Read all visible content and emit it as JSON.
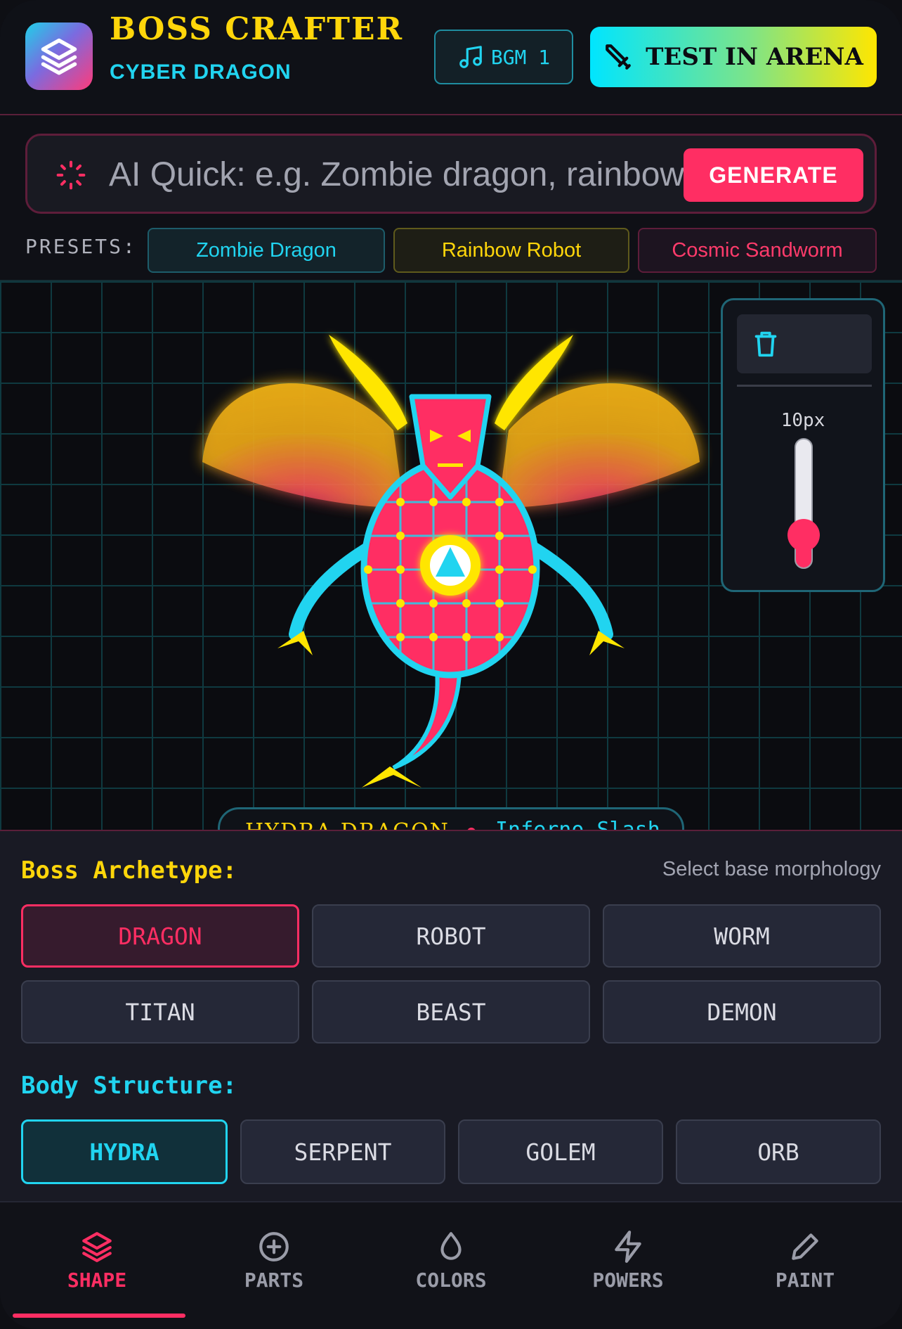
{
  "header": {
    "title": "BOSS CRAFTER",
    "subtitle": "CYBER DRAGON",
    "bgm_label": "BGM 1",
    "arena_label": "TEST IN ARENA"
  },
  "ai_quick": {
    "placeholder": "AI Quick: e.g. Zombie dragon, rainbow robot...",
    "generate_label": "GENERATE"
  },
  "presets": {
    "label": "PRESETS:",
    "items": [
      "Zombie Dragon",
      "Rainbow Robot",
      "Cosmic Sandworm"
    ]
  },
  "canvas": {
    "brush_size": "10px",
    "brush_level": 0.25,
    "boss_name": "HYDRA DRAGON",
    "move_name": "Inferno Slash"
  },
  "archetype": {
    "title": "Boss Archetype:",
    "hint": "Select base morphology",
    "options": [
      "DRAGON",
      "ROBOT",
      "WORM",
      "TITAN",
      "BEAST",
      "DEMON"
    ],
    "selected": "DRAGON"
  },
  "structure": {
    "title": "Body Structure:",
    "options": [
      "HYDRA",
      "SERPENT",
      "GOLEM",
      "ORB"
    ],
    "selected": "HYDRA"
  },
  "nav": {
    "items": [
      {
        "label": "SHAPE",
        "icon": "layers-icon"
      },
      {
        "label": "PARTS",
        "icon": "plus-circle-icon"
      },
      {
        "label": "COLORS",
        "icon": "droplet-icon"
      },
      {
        "label": "POWERS",
        "icon": "bolt-icon"
      },
      {
        "label": "PAINT",
        "icon": "pencil-icon"
      }
    ],
    "active": "SHAPE"
  },
  "colors": {
    "accent_pink": "#ff2e63",
    "accent_cyan": "#21d4f0",
    "accent_yellow": "#ffd60a"
  }
}
